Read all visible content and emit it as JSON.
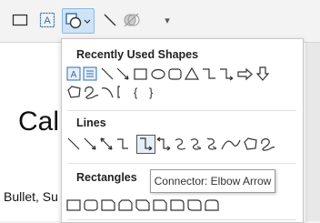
{
  "ribbon": {
    "tools": [
      {
        "name": "rectangle-icon"
      },
      {
        "name": "text-box-icon",
        "glyph": "A"
      },
      {
        "name": "shapes-icon"
      },
      {
        "name": "line-icon"
      },
      {
        "name": "shape-effects-icon"
      },
      {
        "name": "more-icon",
        "glyph": "▾"
      }
    ]
  },
  "document": {
    "heading_fragment": "Cali",
    "bullet_fragment": "Bullet, Su"
  },
  "shapes_menu": {
    "sections": [
      {
        "title": "Recently Used Shapes"
      },
      {
        "title": "Lines"
      },
      {
        "title": "Rectangles"
      }
    ],
    "tooltip": "Connector: Elbow Arrow"
  },
  "colors": {
    "accent_blue": "#2b6cb0",
    "selection_bg": "#cfe3f7",
    "menu_border": "#c8c8c8"
  }
}
